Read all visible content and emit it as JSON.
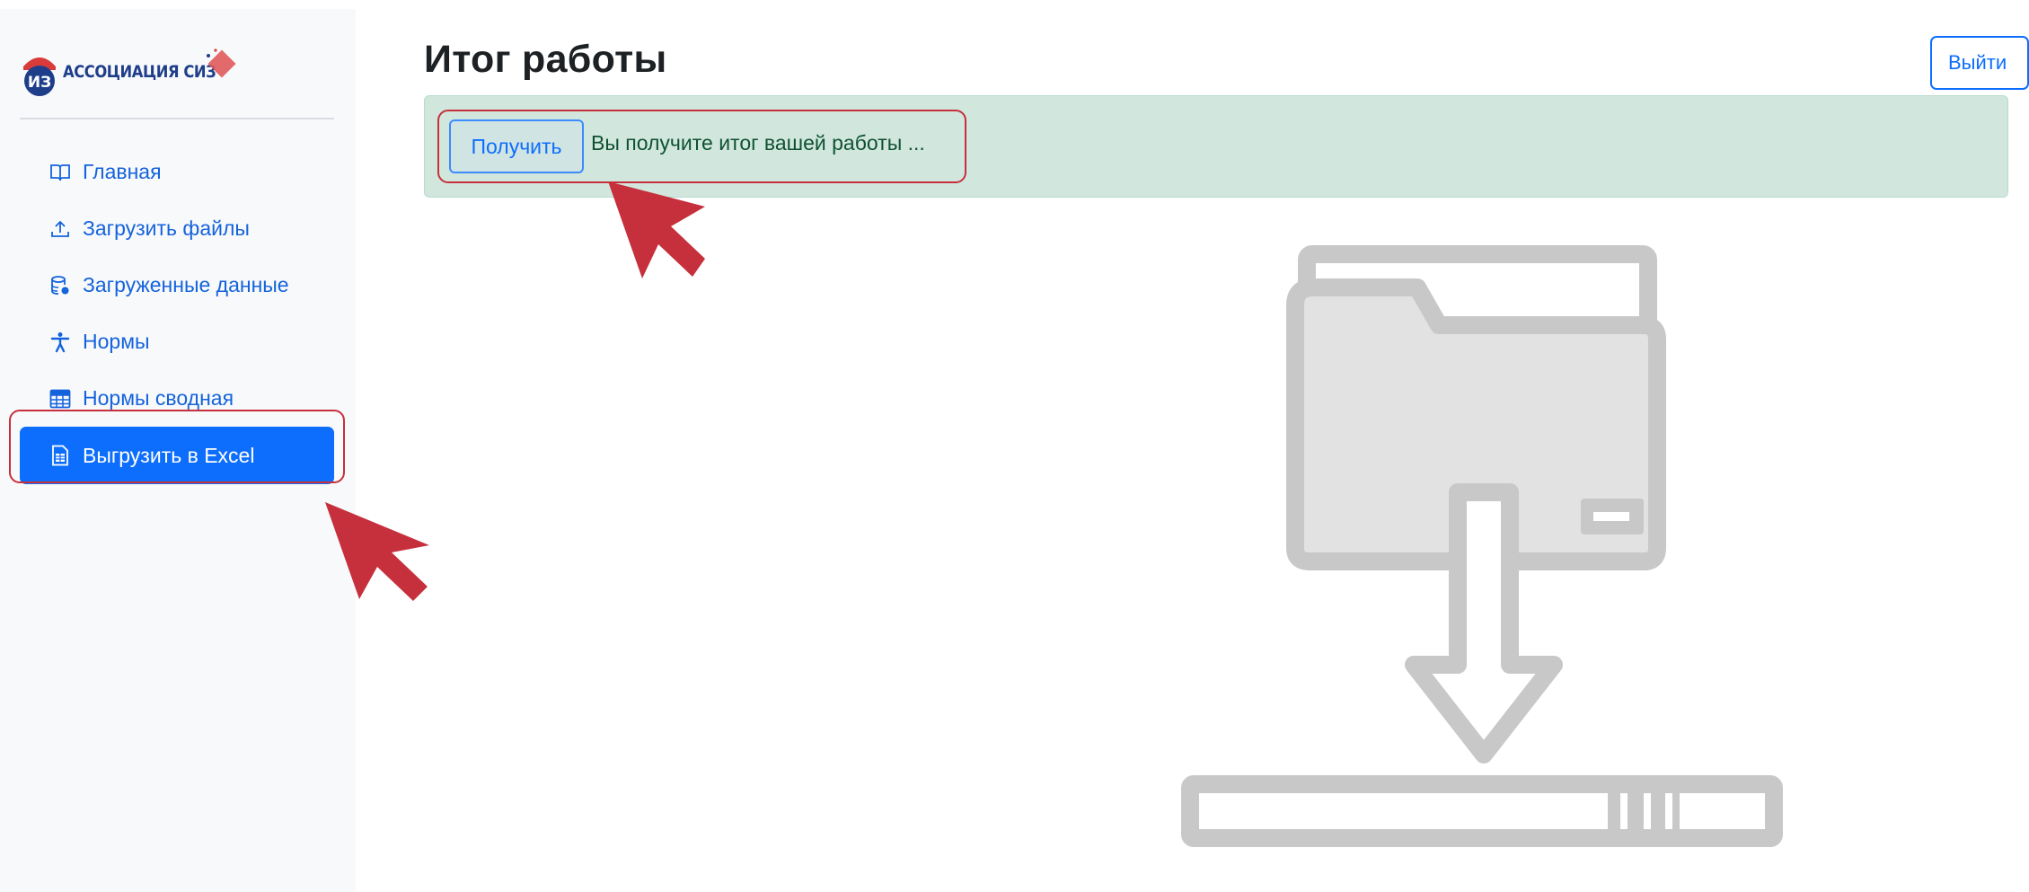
{
  "brand": {
    "logo_text": "АССОЦИАЦИЯ СИЗ"
  },
  "sidebar": {
    "items": [
      {
        "label": "Главная",
        "icon": "book-icon",
        "active": false
      },
      {
        "label": "Загрузить файлы",
        "icon": "upload-icon",
        "active": false
      },
      {
        "label": "Загруженные данные",
        "icon": "database-icon",
        "active": false
      },
      {
        "label": "Нормы",
        "icon": "person-icon",
        "active": false
      },
      {
        "label": "Нормы сводная",
        "icon": "table-icon",
        "active": false
      },
      {
        "label": "Выгрузить в Excel",
        "icon": "file-spreadsheet-icon",
        "active": true
      }
    ]
  },
  "header": {
    "title": "Итог работы",
    "logout_label": "Выйти"
  },
  "alert": {
    "button_label": "Получить",
    "message": "Вы получите итог вашей работы ..."
  },
  "colors": {
    "primary": "#0d6efd",
    "sidebar_bg": "#f8f9fb",
    "alert_bg": "#d1e7dd",
    "highlight": "#c6303c",
    "illustration": "#c8c8c8"
  }
}
